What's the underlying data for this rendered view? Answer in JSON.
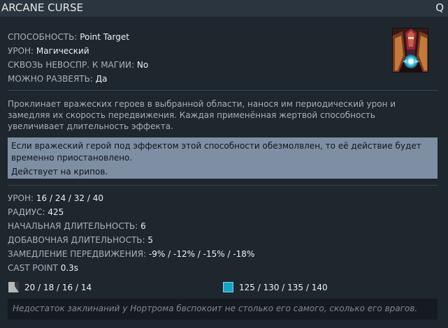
{
  "tooltip": {
    "title": "ARCANE CURSE",
    "hotkey": "Q"
  },
  "properties": [
    {
      "key": "СПОСОБНОСТЬ:",
      "value": "Point Target"
    },
    {
      "key": "УРОН:",
      "value": "Магический"
    },
    {
      "key": "СКВОЗЬ НЕВОСПР. К МАГИИ:",
      "value": "No"
    },
    {
      "key": "МОЖНО РАЗВЕЯТЬ:",
      "value": "Да"
    }
  ],
  "ability_icon": "arcane-curse-ability-icon",
  "description": "Проклинает вражеских героев в выбранной области, нанося им периодический урон и замедляя их скорость передвижения. Каждая применённая жертвой способность увеличивает длительность эффекта.",
  "note": {
    "line1": "Если вражеский герой под эффектом этой способности обезмолвлен, то её действие будет временно приостановлено.",
    "line2": "Действует на крипов."
  },
  "stats": [
    {
      "key": "УРОН:",
      "value": "16 / 24 / 32 / 40"
    },
    {
      "key": "РАДИУС:",
      "value": "425"
    },
    {
      "key": "НАЧАЛЬНАЯ ДЛИТЕЛЬНОСТЬ:",
      "value": "6"
    },
    {
      "key": "ДОБАВОЧНАЯ ДЛИТЕЛЬНОСТЬ:",
      "value": "5"
    },
    {
      "key": "ЗАМЕДЛЕНИЕ ПЕРЕДВИЖЕНИЯ:",
      "value": "-9% / -12% / -15% / -18%"
    },
    {
      "key": "CAST POINT",
      "value": "0.3s"
    }
  ],
  "costs": {
    "cooldown_icon": "cooldown-icon",
    "cooldown": "20 / 18 / 16 / 14",
    "mana_icon": "mana-icon",
    "mana": "125 / 130 / 135 / 140"
  },
  "lore": "Недостаток заклинаний у Нортрома бвспокоит не столько его самого, сколько его врагов.",
  "colors": {
    "header_bg": "#2b3540",
    "body_bg": "#1e262e",
    "note_bg": "#7e8fa3",
    "mana": "#19a3c4"
  }
}
